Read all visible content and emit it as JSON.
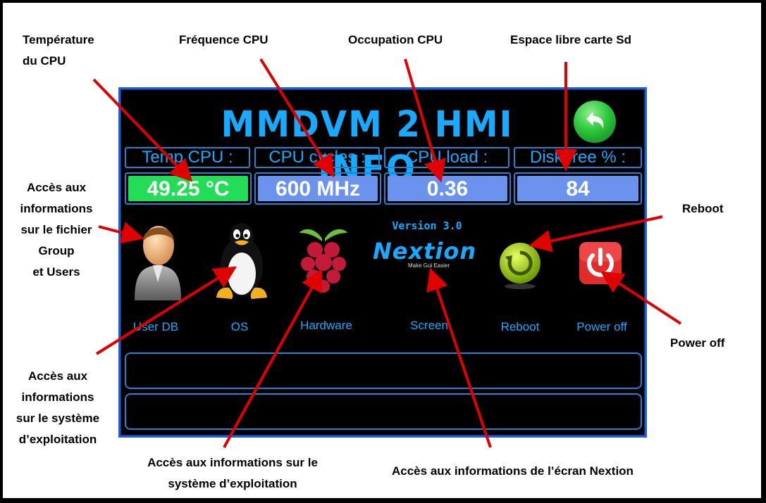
{
  "screen": {
    "title": "MMDVM 2 HMI INFO",
    "labels": {
      "temp": "Temp CPU :",
      "cycles": "CPU cycles :",
      "load": "CPU load :",
      "disk": "Disk free % :"
    },
    "values": {
      "temp": "49.25 °C",
      "cycles": "600 MHz",
      "load": "0.36",
      "disk": "84"
    },
    "version": "Version 3.0",
    "nextion_logo": "Nextion",
    "nextion_tagline": "Make Gui Easier",
    "buttons": {
      "userdb": "User DB",
      "os": "OS",
      "hardware": "Hardware",
      "screen": "Screen",
      "reboot": "Reboot",
      "poweroff": "Power off"
    },
    "colors": {
      "accent": "#17aaff",
      "temp_bg": "#22dd55",
      "value_bg": "#6b93ee"
    }
  },
  "annotations": {
    "temp": [
      "Température",
      "du CPU"
    ],
    "freq": "Fréquence CPU",
    "occupation": "Occupation CPU",
    "disk": "Espace libre carte Sd",
    "userdb": [
      "Accès aux",
      "informations",
      "sur le fichier",
      "Group",
      "et Users"
    ],
    "reboot": "Reboot",
    "poweroff": "Power off",
    "os": [
      "Accès aux",
      "informations",
      "sur le système",
      "d’exploitation"
    ],
    "hardware": [
      "Accès aux informations sur le",
      "système d’exploitation"
    ],
    "screen": "Accès aux informations de l’écran Nextion"
  }
}
